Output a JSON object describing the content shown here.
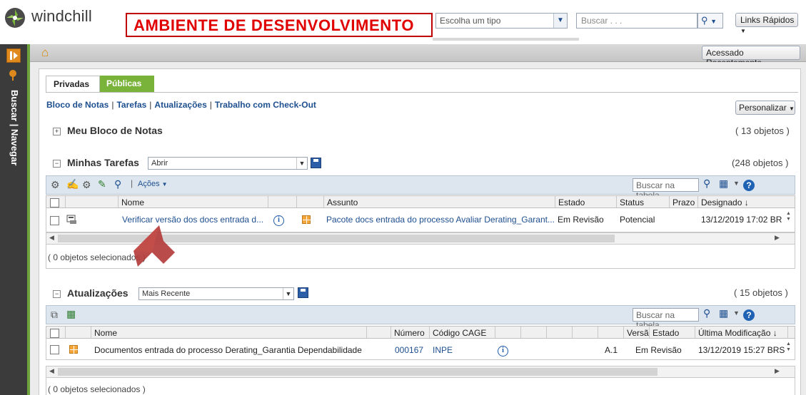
{
  "header": {
    "brand": "windchill",
    "environment_label": "AMBIENTE DE DESENVOLVIMENTO",
    "type_select": "Escolha um tipo",
    "search_placeholder": "Buscar . . .",
    "quick_links": "Links Rápidos",
    "recent": "Acessado Recentemente"
  },
  "rail": {
    "label": "Buscar | Navegar"
  },
  "tabs": {
    "private": "Privadas",
    "public": "Públicas"
  },
  "nav": {
    "notebook": "Bloco de Notas",
    "tasks": "Tarefas",
    "updates": "Atualizações",
    "checkout": "Trabalho com Check-Out",
    "personalize": "Personalizar"
  },
  "notebook": {
    "title": "Meu Bloco de Notas",
    "count": "( 13 objetos )"
  },
  "tasks": {
    "title": "Minhas Tarefas",
    "view": "Abrir",
    "count": "(248 objetos )",
    "actions": "Ações",
    "search_placeholder": "Buscar na tabela",
    "columns": {
      "name": "Nome",
      "subject": "Assunto",
      "state": "Estado",
      "status": "Status",
      "deadline": "Prazo",
      "assigned": "Designado ↓"
    },
    "row": {
      "name": "Verificar versão dos docs entrada d...",
      "subject": "Pacote docs entrada do processo Avaliar Derating_Garant...",
      "state": "Em Revisão",
      "status": "Potencial",
      "assigned": "13/12/2019 17:02 BR"
    },
    "selected": "( 0 objetos selecionados )"
  },
  "updates": {
    "title": "Atualizações",
    "view": "Mais Recente",
    "count": "( 15 objetos )",
    "search_placeholder": "Buscar na tabela",
    "columns": {
      "name": "Nome",
      "number": "Número",
      "cage": "Código CAGE",
      "version": "Versão",
      "state": "Estado",
      "modified": "Última Modificação ↓"
    },
    "row": {
      "name": "Documentos entrada do processo Derating_Garantia Dependabilidade",
      "number": "000167",
      "cage": "INPE",
      "version": "A.1",
      "state": "Em Revisão",
      "modified": "13/12/2019 15:27 BRS"
    },
    "selected": "( 0 objetos selecionados )"
  },
  "colors": {
    "accent_green": "#7ab33a",
    "env_red": "#e00000",
    "link_blue": "#1e4f8f",
    "arrow": "#b33c3c"
  }
}
